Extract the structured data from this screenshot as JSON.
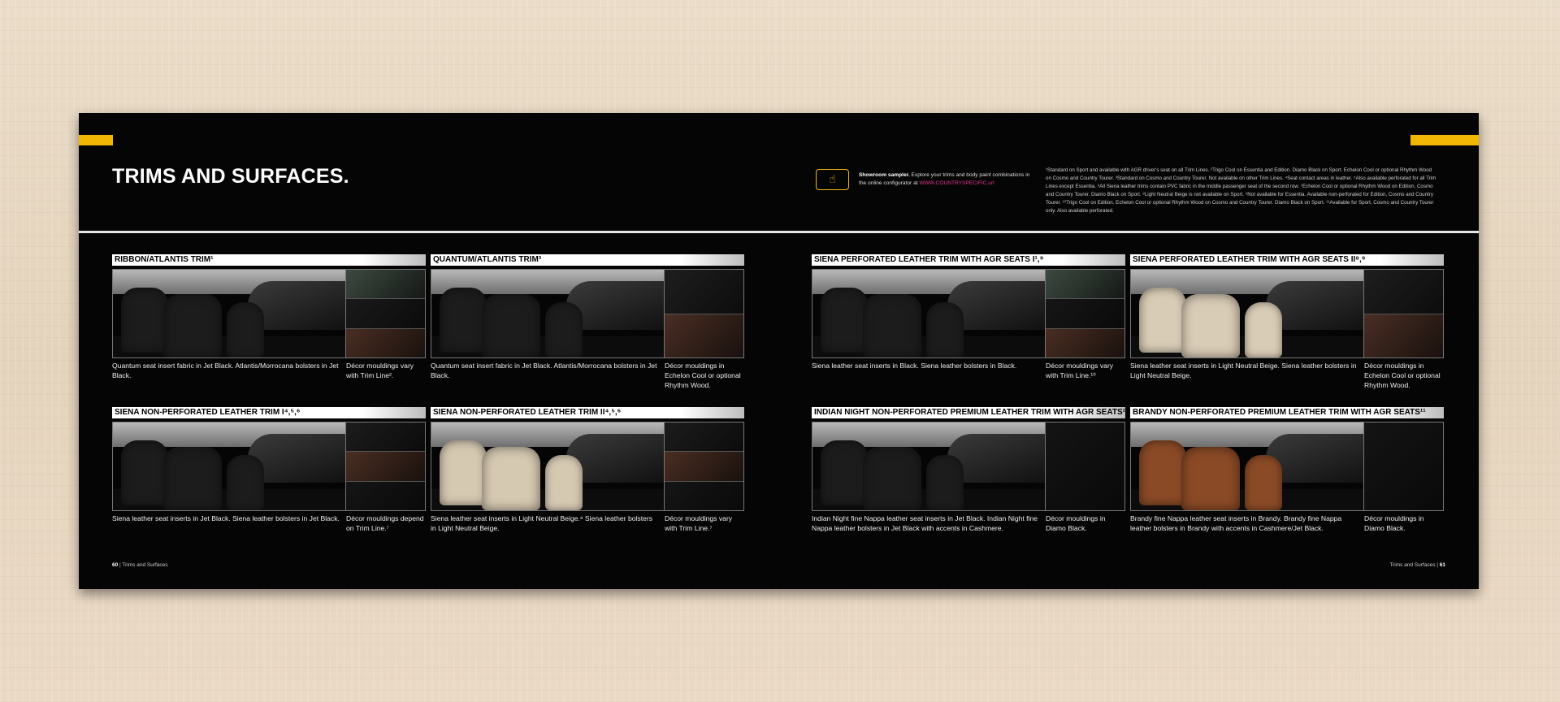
{
  "title": "TRIMS AND SURFACES.",
  "showroom": {
    "bold": "Showroom sampler.",
    "text": " Explore your trims and body paint combinations in the online configurator at ",
    "url": "WWW.COUNTRYSPECIFIC.url"
  },
  "footnotes": "¹Standard on Sport and available with AGR driver's seat on all Trim Lines. ²Trigo Cool on Essentia and Edition. Diamo Black on Sport. Echelon Cool or optional Rhythm Wood on Cosmo and Country Tourer. ³Standard on Cosmo and Country Tourer. Not available on other Trim Lines. ⁴Seat contact areas in leather. ⁵Also available perforated for all Trim Lines except Essentia. ⁶All Siena leather trims contain PVC fabric in the middle passenger seat of the second row. ⁷Echelon Cool or optional Rhythm Wood on Edition, Cosmo and Country Tourer. Diamo Black on Sport. ⁸Light Neutral Beige is not available on Sport. ⁹Not available for Essentia. Available non-perforated for Edition, Cosmo and Country Tourer. ¹⁰Trigo Cool on Edition. Echelon Cool or optional Rhythm Wood on Cosmo and Country Tourer. Diamo Black on Sport. ¹¹Available for Sport, Cosmo and Country Tourer only. Also available perforated.",
  "panels": [
    {
      "title": "RIBBON/ATLANTIS TRIM¹",
      "desc": "Quantum seat insert fabric in Jet Black. Atlantis/Morrocana bolsters in Jet Black.",
      "side": "Décor mouldings vary with Trim Line².",
      "seat_color": "#1c1c1c",
      "swatches": [
        "#3d4a40",
        "#1a1a1a",
        "#4a2e22"
      ]
    },
    {
      "title": "QUANTUM/ATLANTIS  TRIM³",
      "desc": "Quantum seat insert fabric in Jet Black. Atlantis/Morrocana bolsters in Jet Black.",
      "side": "Décor mouldings in Echelon Cool or optional Rhythm Wood.",
      "seat_color": "#1c1c1c",
      "swatches": [
        "#1e1e1e",
        "#4a2e24"
      ]
    },
    {
      "title": "SIENA PERFORATED LEATHER TRIM WITH AGR SEATS I¹,⁹",
      "desc": "Siena leather seat inserts in Black. Siena leather bolsters in Black.",
      "side": "Décor mouldings vary with Trim Line.¹⁰",
      "seat_color": "#1c1c1c",
      "swatches": [
        "#3d4a40",
        "#161616",
        "#4a2e22"
      ]
    },
    {
      "title": "SIENA PERFORATED LEATHER TRIM WITH AGR SEATS II⁸,⁹",
      "desc": "Siena leather seat inserts in Light Neutral Beige. Siena leather bolsters in Light Neutral Beige.",
      "side": "Décor mouldings in Echelon Cool or optional Rhythm Wood.",
      "seat_color": "#d9ccb6",
      "swatches": [
        "#1e1e1e",
        "#4a2e24"
      ]
    },
    {
      "title": "SIENA NON-PERFORATED LEATHER TRIM I⁴,⁵,⁶",
      "desc": "Siena leather seat inserts in Jet Black. Siena leather bolsters in Jet Black.",
      "side": "Décor mouldings depend on Trim Line.⁷",
      "seat_color": "#1c1c1c",
      "swatches": [
        "#1c1c1c",
        "#4a2e22",
        "#151515"
      ]
    },
    {
      "title": "SIENA NON-PERFORATED LEATHER TRIM II⁴,⁵,⁶",
      "desc": "Siena leather seat inserts in Light Neutral Beige.⁸ Siena leather bolsters in Light Neutral Beige.",
      "side": "Décor mouldings vary with Trim Line.⁷",
      "seat_color": "#d6c9b2",
      "swatches": [
        "#1c1c1c",
        "#4a2e22",
        "#151515"
      ]
    },
    {
      "title": "INDIAN NIGHT NON-PERFORATED PREMIUM LEATHER TRIM WITH AGR SEATS¹¹",
      "desc": "Indian Night fine Nappa leather seat inserts in Jet Black. Indian Night fine Nappa leather bolsters in Jet Black with accents in Cashmere.",
      "side": "Décor mouldings in Diamo Black.",
      "seat_color": "#1c1c1c",
      "swatches": [
        "#141414"
      ]
    },
    {
      "title": "BRANDY NON-PERFORATED PREMIUM LEATHER TRIM WITH AGR SEATS¹¹",
      "desc": "Brandy fine Nappa leather seat inserts in Brandy. Brandy fine Nappa leather bolsters in Brandy with accents in Cashmere/Jet Black.",
      "side": "Décor mouldings in Diamo Black.",
      "seat_color": "#8a4a26",
      "swatches": [
        "#141414"
      ]
    }
  ],
  "footer_left": {
    "page": "60",
    "label": "Trims and Surfaces"
  },
  "footer_right": {
    "page": "61",
    "label": "Trims and Surfaces"
  },
  "colors": {
    "accent": "#f2b705",
    "link": "#e3348e",
    "background": "#050505"
  }
}
